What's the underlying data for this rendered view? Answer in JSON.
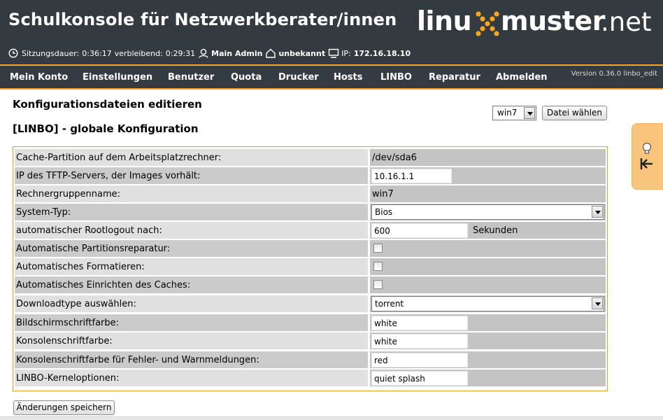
{
  "header": {
    "title": "Schulkonsole für Netzwerkberater/innen",
    "logo": {
      "part1": "linu",
      "part2": "muster",
      "part3": ".net"
    },
    "session": {
      "label": "Sitzungsdauer:",
      "duration": "0:36:17",
      "remaining_label": "verbleibend:",
      "remaining": "0:29:31",
      "user": "Main Admin",
      "room": "unbekannt",
      "ip_label": "IP:",
      "ip": "172.16.18.10"
    },
    "colors": {
      "bg": "#333a40",
      "accent": "#f5a623"
    }
  },
  "nav": {
    "items": [
      "Mein Konto",
      "Einstellungen",
      "Benutzer",
      "Quota",
      "Drucker",
      "Hosts",
      "LINBO",
      "Reparatur",
      "Abmelden"
    ],
    "version": "Version 0.36.0 linbo_edit"
  },
  "page": {
    "heading": "Konfigurationsdateien editieren",
    "subheading": "[LINBO] - globale Konfiguration",
    "file_select": {
      "value": "win7"
    },
    "choose_button": "Datei wählen",
    "save_button": "Änderungen speichern"
  },
  "config": {
    "rows": [
      {
        "label": "Cache-Partition auf dem Arbeitsplatzrechner:",
        "value": "/dev/sda6"
      },
      {
        "label": "IP des TFTP-Servers, der Images vorhält:",
        "value": "10.16.1.1"
      },
      {
        "label": "Rechnergruppenname:",
        "value": "win7"
      },
      {
        "label": "System-Typ:",
        "value": "Bios"
      },
      {
        "label": "automatischer Rootlogout nach:",
        "value": "600",
        "unit": "Sekunden"
      },
      {
        "label": "Automatische Partitionsreparatur:",
        "checked": false
      },
      {
        "label": "Automatisches Formatieren:",
        "checked": false
      },
      {
        "label": "Automatisches Einrichten des Caches:",
        "checked": false
      },
      {
        "label": "Downloadtype auswählen:",
        "value": "torrent"
      },
      {
        "label": "Bildschirmschriftfarbe:",
        "value": "white"
      },
      {
        "label": "Konsolenschriftfarbe:",
        "value": "white"
      },
      {
        "label": "Konsolenschriftfarbe für Fehler- und Warnmeldungen:",
        "value": "red"
      },
      {
        "label": "LINBO-Kerneloptionen:",
        "value": "quiet splash"
      }
    ]
  },
  "sidetab": {
    "icons": [
      "lightbulb-icon",
      "collapse-left-icon"
    ]
  }
}
